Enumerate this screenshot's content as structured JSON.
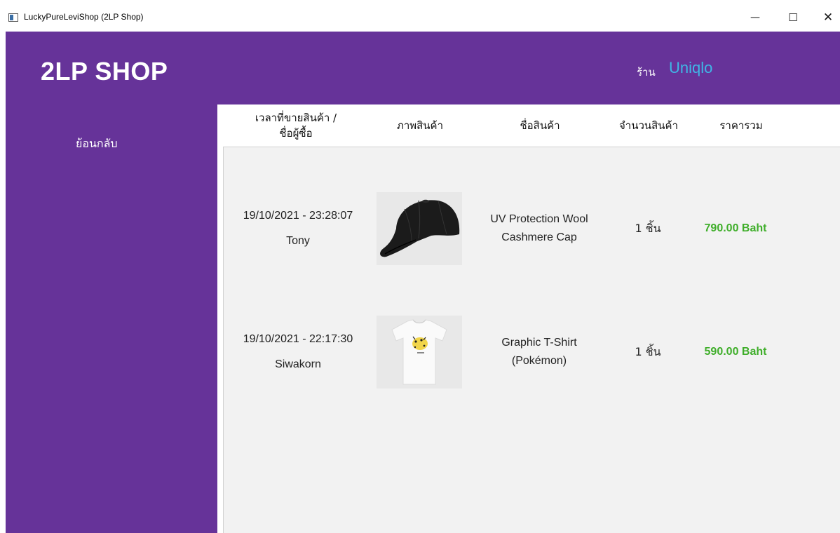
{
  "window": {
    "title": "LuckyPureLeviShop (2LP Shop)",
    "controls": {
      "minimize": "—",
      "maximize": "☐",
      "close": "✕"
    }
  },
  "header": {
    "brand": "2LP SHOP",
    "shop_label": "ร้าน",
    "shop_name": "Uniqlo",
    "colors": {
      "background": "#663399",
      "shop_name": "#3fb7e6"
    }
  },
  "sidebar": {
    "back_label": "ย้อนกลับ"
  },
  "table": {
    "columns": [
      "เวลาที่ขายสินค้า / ชื่อผู้ซื้อ",
      "ภาพสินค้า",
      "ชื่อสินค้า",
      "จำนวนสินค้า",
      "ราคารวม"
    ],
    "col0_line1": "เวลาที่ขายสินค้า /",
    "col0_line2": "ชื่อผู้ซื้อ",
    "rows": [
      {
        "timestamp": "19/10/2021 - 23:28:07",
        "buyer": "Tony",
        "image": "black-cap-image",
        "product_line1": "UV Protection Wool",
        "product_line2": "Cashmere Cap",
        "quantity": "1 ชิ้น",
        "price": "790.00 Baht"
      },
      {
        "timestamp": "19/10/2021 - 22:17:30",
        "buyer": "Siwakorn",
        "image": "white-tshirt-image",
        "product_line1": "Graphic T-Shirt",
        "product_line2": "(Pokémon)",
        "quantity": "1 ชิ้น",
        "price": "590.00 Baht"
      }
    ],
    "price_color": "#3fae2a"
  }
}
